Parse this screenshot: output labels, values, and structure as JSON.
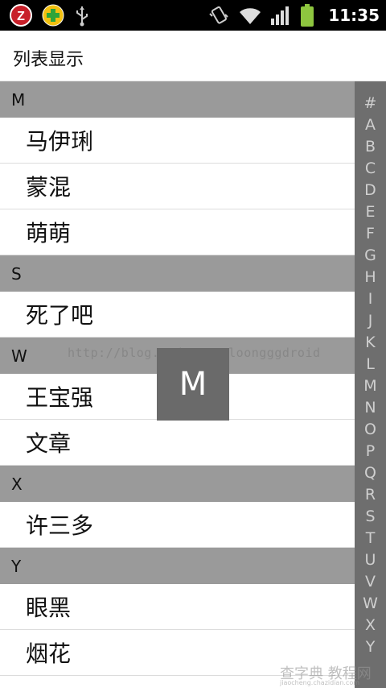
{
  "status_bar": {
    "time": "11:35",
    "icons": [
      "app-z-icon",
      "plus-app-icon",
      "usb-icon",
      "vibrate-icon",
      "wifi-icon",
      "signal-icon",
      "battery-icon"
    ]
  },
  "title_bar": {
    "title": "列表显示"
  },
  "list": {
    "sections": [
      {
        "header": "M",
        "items": [
          "马伊琍",
          "蒙混",
          "萌萌"
        ]
      },
      {
        "header": "S",
        "items": [
          "死了吧"
        ]
      },
      {
        "header": "W",
        "items": [
          "王宝强",
          "文章"
        ]
      },
      {
        "header": "X",
        "items": [
          "许三多"
        ]
      },
      {
        "header": "Y",
        "items": [
          "眼黑",
          "烟花"
        ]
      }
    ]
  },
  "index_bar": {
    "letters": [
      "#",
      "A",
      "B",
      "C",
      "D",
      "E",
      "F",
      "G",
      "H",
      "I",
      "J",
      "K",
      "L",
      "M",
      "N",
      "O",
      "P",
      "Q",
      "R",
      "S",
      "T",
      "U",
      "V",
      "W",
      "X",
      "Y"
    ]
  },
  "overlay": {
    "letter": "M"
  },
  "watermark": {
    "text": "http://blog.csdn.net/loongggdroid"
  },
  "colors": {
    "status_bar": "#000000",
    "section_header": "#9a9a9a",
    "index_bar": "#6e6e6e",
    "overlay": "#6a6a6a",
    "battery": "#8ec63f"
  }
}
